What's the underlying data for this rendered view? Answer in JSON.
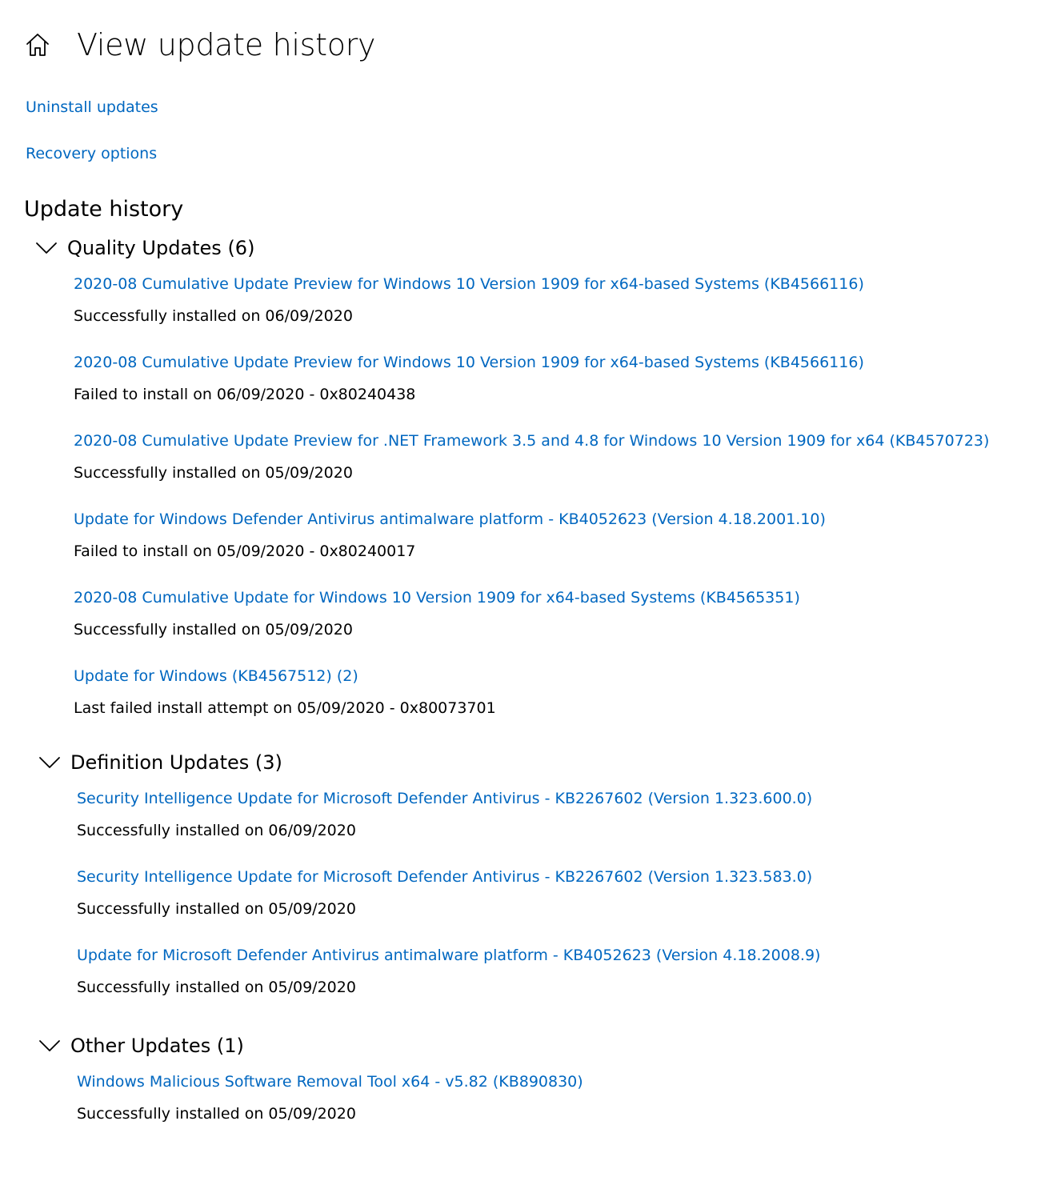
{
  "header": {
    "home_icon": "home-icon",
    "title": "View update history"
  },
  "links": {
    "uninstall": "Uninstall updates",
    "recovery": "Recovery options"
  },
  "section_title": "Update history",
  "colors": {
    "link": "#0067c0",
    "text": "#000000",
    "background": "#ffffff"
  },
  "groups": [
    {
      "title": "Quality Updates (6)",
      "expanded": true,
      "icon": "chevron-down-icon",
      "items": [
        {
          "name": "2020-08 Cumulative Update Preview for Windows 10 Version 1909 for x64-based Systems (KB4566116)",
          "status": "Successfully installed on 06/09/2020"
        },
        {
          "name": "2020-08 Cumulative Update Preview for Windows 10 Version 1909 for x64-based Systems (KB4566116)",
          "status": "Failed to install on 06/09/2020 - 0x80240438"
        },
        {
          "name": "2020-08 Cumulative Update Preview for .NET Framework 3.5 and 4.8 for Windows 10 Version 1909 for x64 (KB4570723)",
          "status": "Successfully installed on 05/09/2020"
        },
        {
          "name": "Update for Windows Defender Antivirus antimalware platform - KB4052623 (Version 4.18.2001.10)",
          "status": "Failed to install on 05/09/2020 - 0x80240017"
        },
        {
          "name": "2020-08 Cumulative Update for Windows 10 Version 1909 for x64-based Systems (KB4565351)",
          "status": "Successfully installed on 05/09/2020"
        },
        {
          "name": "Update for Windows (KB4567512) (2)",
          "status": "Last failed install attempt on 05/09/2020 - 0x80073701"
        }
      ]
    },
    {
      "title": "Definition Updates (3)",
      "expanded": true,
      "icon": "chevron-down-icon",
      "items": [
        {
          "name": "Security Intelligence Update for Microsoft Defender Antivirus - KB2267602 (Version 1.323.600.0)",
          "status": "Successfully installed on 06/09/2020"
        },
        {
          "name": "Security Intelligence Update for Microsoft Defender Antivirus - KB2267602 (Version 1.323.583.0)",
          "status": "Successfully installed on 05/09/2020"
        },
        {
          "name": "Update for Microsoft Defender Antivirus antimalware platform - KB4052623 (Version 4.18.2008.9)",
          "status": "Successfully installed on 05/09/2020"
        }
      ]
    },
    {
      "title": "Other Updates (1)",
      "expanded": true,
      "icon": "chevron-down-icon",
      "items": [
        {
          "name": "Windows Malicious Software Removal Tool x64 - v5.82 (KB890830)",
          "status": "Successfully installed on 05/09/2020"
        }
      ]
    }
  ]
}
